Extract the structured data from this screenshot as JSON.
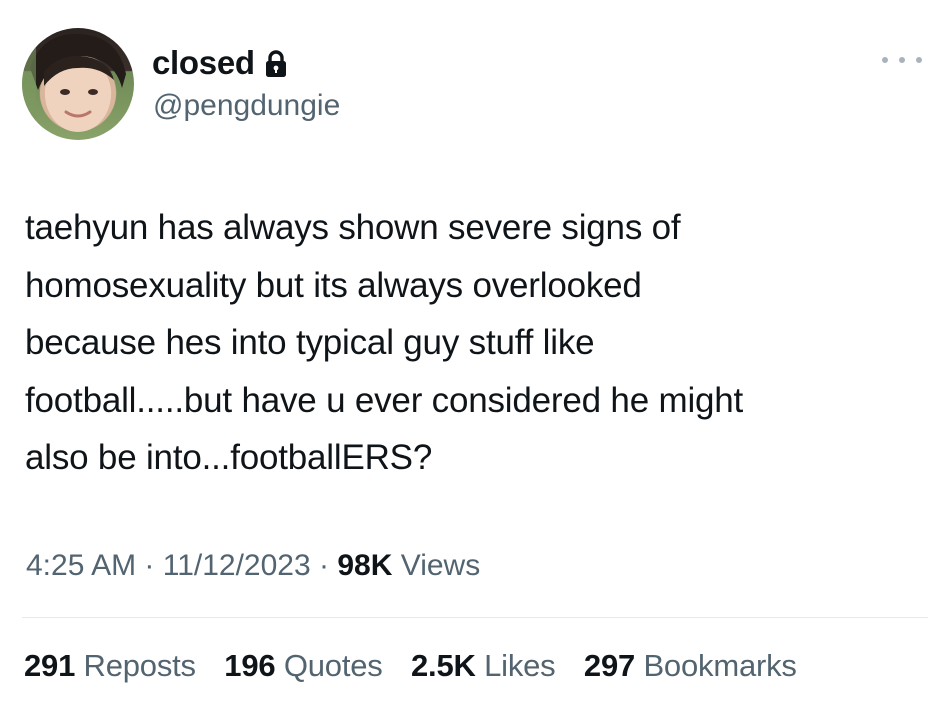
{
  "author": {
    "display_name": "closed",
    "handle": "@pengdungie",
    "avatar_icon": "profile-photo",
    "lock_icon": "lock-icon"
  },
  "tweet": {
    "text": "taehyun has always shown severe signs of\nhomosexuality but its always overlooked\nbecause hes into typical guy stuff like\nfootball.....but have u ever considered he might\nalso be into...footballERS?"
  },
  "meta": {
    "time": "4:25 AM",
    "sep1": " · ",
    "date": "11/12/2023",
    "sep2": " · ",
    "views_count": "98K",
    "views_label": " Views"
  },
  "stats": {
    "reposts_count": "291",
    "reposts_label": " Reposts",
    "quotes_count": "196",
    "quotes_label": " Quotes",
    "likes_count": "2.5K",
    "likes_label": " Likes",
    "bookmarks_count": "297",
    "bookmarks_label": " Bookmarks"
  },
  "colors": {
    "text": "#0f1419",
    "secondary": "#536471",
    "divider": "#e6e9ec"
  }
}
